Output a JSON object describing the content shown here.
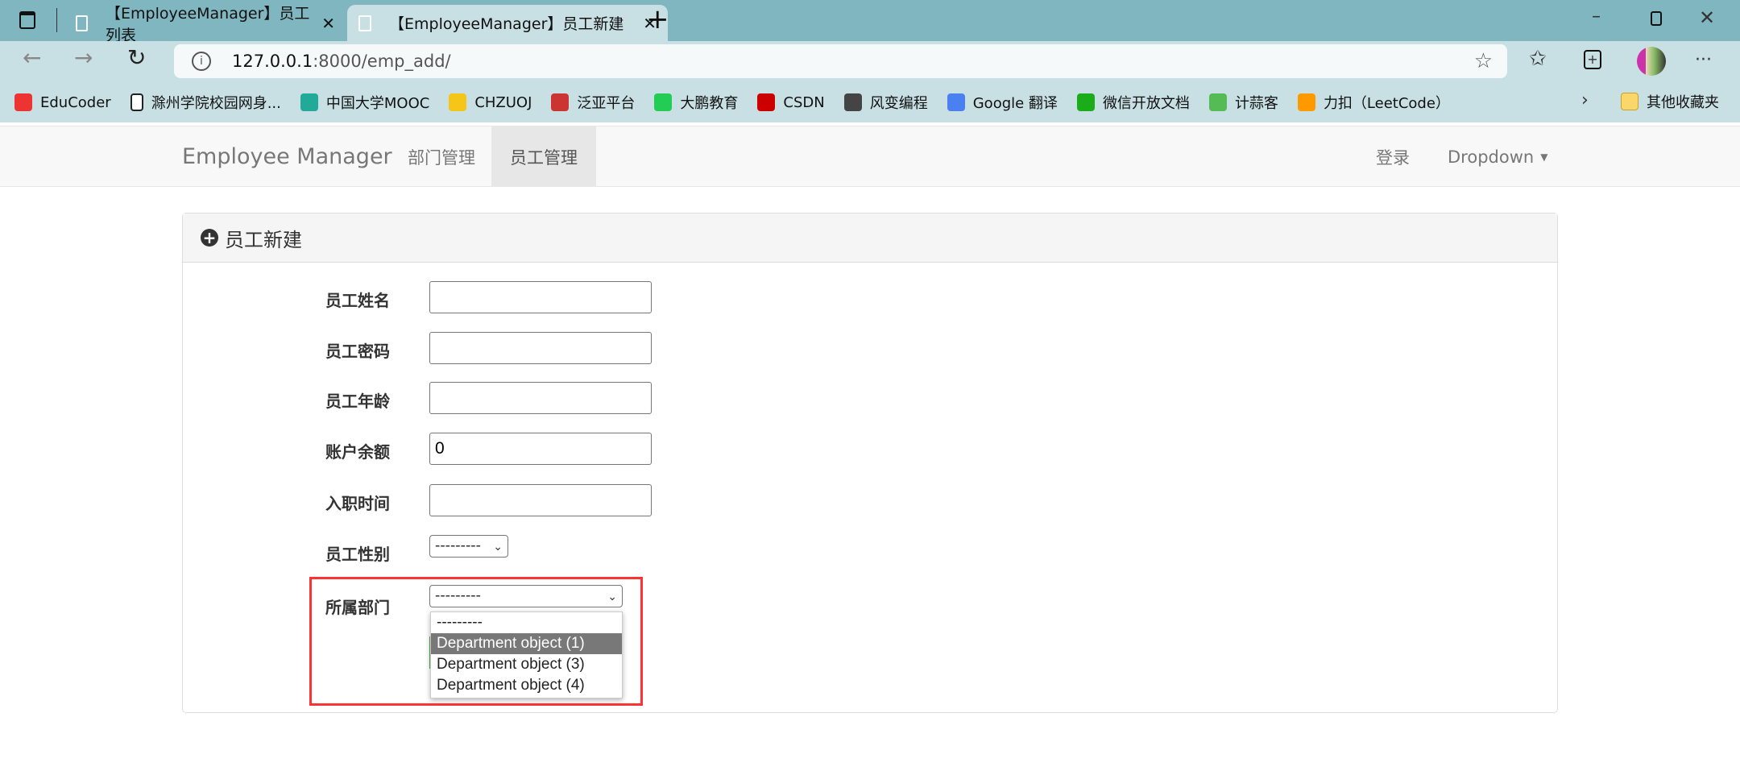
{
  "browser": {
    "tabs": [
      {
        "title": "【EmployeeManager】员工列表",
        "active": false
      },
      {
        "title": "【EmployeeManager】员工新建",
        "active": true
      }
    ],
    "url_host": "127.0.0.1",
    "url_rest": ":8000/emp_add/",
    "bookmarks": [
      {
        "label": "EduCoder",
        "color": "#e33"
      },
      {
        "label": "滁州学院校园网身...",
        "color": "#fff"
      },
      {
        "label": "中国大学MOOC",
        "color": "#2a9"
      },
      {
        "label": "CHZUOJ",
        "color": "#f5c518"
      },
      {
        "label": "泛亚平台",
        "color": "#c33"
      },
      {
        "label": "大鹏教育",
        "color": "#2c5"
      },
      {
        "label": "CSDN",
        "color": "#c00"
      },
      {
        "label": "风变编程",
        "color": "#444"
      },
      {
        "label": "Google 翻译",
        "color": "#4a80f0"
      },
      {
        "label": "微信开放文档",
        "color": "#1aad19"
      },
      {
        "label": "计蒜客",
        "color": "#5b5"
      },
      {
        "label": "力扣（LeetCode）",
        "color": "#f90"
      }
    ],
    "other_bookmarks": "其他收藏夹"
  },
  "navbar": {
    "brand": "Employee Manager",
    "items": [
      {
        "label": "部门管理",
        "active": false
      },
      {
        "label": "员工管理",
        "active": true
      }
    ],
    "login": "登录",
    "dropdown": "Dropdown"
  },
  "panel": {
    "title": "员工新建"
  },
  "form": {
    "fields": [
      {
        "label": "员工姓名",
        "value": ""
      },
      {
        "label": "员工密码",
        "value": ""
      },
      {
        "label": "员工年龄",
        "value": ""
      },
      {
        "label": "账户余额",
        "value": "0"
      },
      {
        "label": "入职时间",
        "value": ""
      }
    ],
    "gender": {
      "label": "员工性别",
      "value": "---------"
    },
    "depart": {
      "label": "所属部门",
      "value": "---------",
      "options": [
        "---------",
        "Department object (1)",
        "Department object (3)",
        "Department object (4)"
      ],
      "highlighted": "Department object (1)"
    }
  },
  "colors": {
    "highlight": "#ff3333",
    "tabbar": "#7fb6bf"
  }
}
